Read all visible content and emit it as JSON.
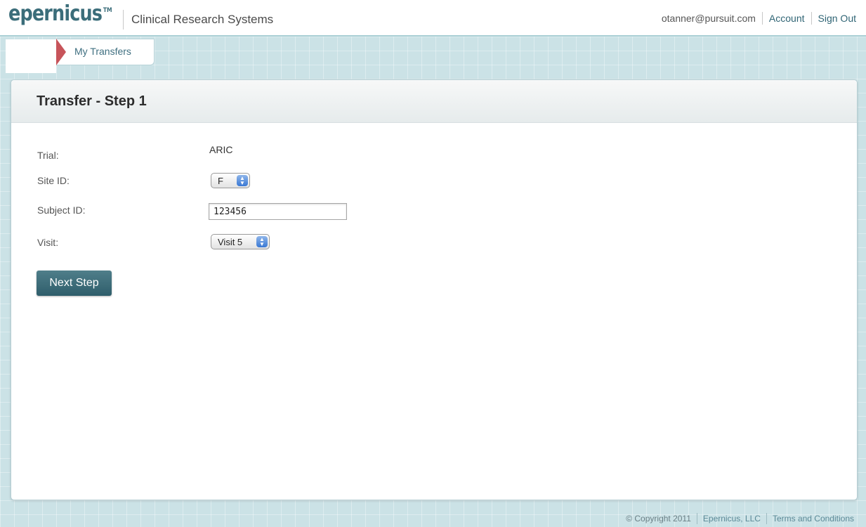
{
  "header": {
    "logo_text": "epernicus",
    "logo_tm": "TM",
    "product_name": "Clinical Research Systems",
    "user_email": "otanner@pursuit.com",
    "account_label": "Account",
    "signout_label": "Sign Out"
  },
  "nav": {
    "tab_label": "My Transfers"
  },
  "panel": {
    "title": "Transfer - Step 1"
  },
  "form": {
    "trial_label": "Trial:",
    "trial_value": "ARIC",
    "site_label": "Site ID:",
    "site_value": "F",
    "subject_label": "Subject ID:",
    "subject_value": "123456",
    "visit_label": "Visit:",
    "visit_value": "Visit 5",
    "next_button": "Next Step"
  },
  "footer": {
    "copyright": "© Copyright 2011",
    "company_link": "Epernicus, LLC",
    "terms_link": "Terms and Conditions"
  },
  "colors": {
    "brand": "#3b6d7a",
    "tab_marker": "#c7545a",
    "background_grid": "#cbe2e6",
    "button": "#3d6b77"
  },
  "icons": {
    "select_arrows": "updown-chevron-icon"
  }
}
